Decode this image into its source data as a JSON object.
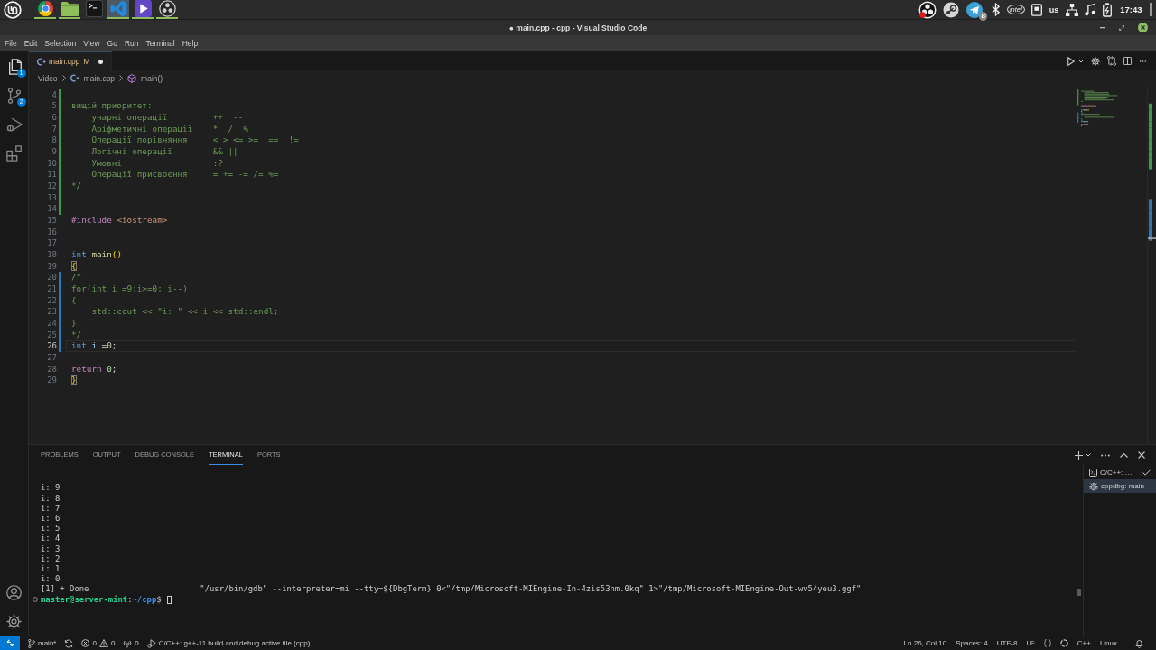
{
  "taskbar": {
    "launchers": [
      {
        "kind": "browser",
        "running": true,
        "selected": false
      },
      {
        "kind": "folder",
        "running": true,
        "selected": false
      },
      {
        "kind": "terminal",
        "running": false,
        "selected": false
      },
      {
        "kind": "editor",
        "running": true,
        "selected": true
      },
      {
        "kind": "player",
        "running": true,
        "selected": false
      },
      {
        "kind": "recorder",
        "running": true,
        "selected": false
      }
    ],
    "tray": [
      {
        "kind": "recorder"
      },
      {
        "kind": "store"
      },
      {
        "kind": "messenger",
        "badge": "8"
      },
      {
        "kind": "bluetooth"
      },
      {
        "kind": "logo",
        "label": "intel"
      },
      {
        "kind": "drive"
      },
      {
        "kind": "layout",
        "label": "us"
      },
      {
        "kind": "network"
      },
      {
        "kind": "sound"
      },
      {
        "kind": "battery"
      }
    ],
    "clock": "17:43"
  },
  "window": {
    "title": "● main.cpp - cpp - Visual Studio Code"
  },
  "menu": [
    "File",
    "Edit",
    "Selection",
    "View",
    "Go",
    "Run",
    "Terminal",
    "Help"
  ],
  "activity_bar": {
    "items": [
      {
        "kind": "explorer",
        "badge": "1",
        "selected": true
      },
      {
        "kind": "source-control",
        "badge": "2",
        "selected": false
      },
      {
        "kind": "run-debug",
        "selected": false
      },
      {
        "kind": "extensions",
        "selected": false
      }
    ],
    "bottom": [
      {
        "kind": "account"
      },
      {
        "kind": "settings"
      }
    ]
  },
  "tabs": [
    {
      "label": "main.cpp",
      "status": "M",
      "modified": true,
      "selected": true
    }
  ],
  "breadcrumbs": [
    {
      "label": "Video",
      "kind": "folder"
    },
    {
      "label": "main.cpp",
      "kind": "file"
    },
    {
      "label": "main()",
      "kind": "symbol"
    }
  ],
  "editor": {
    "lines": [
      {
        "number": "4",
        "added": true,
        "modified": false,
        "current": false
      },
      {
        "number": "5",
        "added": true,
        "modified": false,
        "current": false,
        "tokens": [
          {
            "text": "вищій приоритет:",
            "kind": "comment"
          }
        ]
      },
      {
        "number": "6",
        "added": true,
        "modified": false,
        "current": false,
        "tokens": [
          {
            "text": "    унарні операції         ++  --",
            "kind": "comment"
          }
        ]
      },
      {
        "number": "7",
        "added": true,
        "modified": false,
        "current": false,
        "tokens": [
          {
            "text": "    Аріфметичні операції    *  /  %",
            "kind": "comment"
          }
        ]
      },
      {
        "number": "8",
        "added": true,
        "modified": false,
        "current": false,
        "tokens": [
          {
            "text": "    Операції порівняння     < > <= >=  ==  !=",
            "kind": "comment"
          }
        ]
      },
      {
        "number": "9",
        "added": true,
        "modified": false,
        "current": false,
        "tokens": [
          {
            "text": "    Логічні операції        && ||",
            "kind": "comment"
          }
        ]
      },
      {
        "number": "10",
        "added": true,
        "modified": false,
        "current": false,
        "tokens": [
          {
            "text": "    Умовні                  :?",
            "kind": "comment"
          }
        ]
      },
      {
        "number": "11",
        "added": true,
        "modified": false,
        "current": false,
        "tokens": [
          {
            "text": "    Операції присвоєння     = += -= /= %=",
            "kind": "comment"
          }
        ]
      },
      {
        "number": "12",
        "added": true,
        "modified": false,
        "current": false,
        "tokens": [
          {
            "text": "*/",
            "kind": "comment"
          }
        ]
      },
      {
        "number": "13",
        "added": true,
        "modified": false,
        "current": false
      },
      {
        "number": "14",
        "added": true,
        "modified": false,
        "current": false
      },
      {
        "number": "15",
        "added": false,
        "modified": false,
        "current": false,
        "tokens": [
          {
            "text": "#include",
            "kind": "preproc"
          },
          {
            "text": " <iostream>",
            "kind": "string"
          }
        ]
      },
      {
        "number": "16",
        "added": false,
        "modified": false,
        "current": false
      },
      {
        "number": "17",
        "added": false,
        "modified": false,
        "current": false
      },
      {
        "number": "18",
        "added": false,
        "modified": false,
        "current": false,
        "tokens": [
          {
            "text": "int",
            "kind": "keyword"
          },
          {
            "text": " main",
            "kind": "function"
          },
          {
            "text": "()",
            "kind": "bracket"
          }
        ]
      },
      {
        "number": "19",
        "added": false,
        "modified": false,
        "current": false,
        "tokens": [
          {
            "text": "{",
            "kind": "matched-bracket"
          }
        ]
      },
      {
        "number": "20",
        "added": false,
        "modified": true,
        "current": false,
        "tokens": [
          {
            "text": "/*",
            "kind": "comment"
          }
        ]
      },
      {
        "number": "21",
        "added": false,
        "modified": true,
        "current": false,
        "tokens": [
          {
            "text": "for(int i =9;i>=0; i--)",
            "kind": "comment"
          }
        ]
      },
      {
        "number": "22",
        "added": false,
        "modified": true,
        "current": false,
        "tokens": [
          {
            "text": "{",
            "kind": "comment"
          }
        ]
      },
      {
        "number": "23",
        "added": false,
        "modified": true,
        "current": false,
        "tokens": [
          {
            "text": "    std::cout << \"i: \" << i << std::endl;",
            "kind": "comment"
          }
        ]
      },
      {
        "number": "24",
        "added": false,
        "modified": true,
        "current": false,
        "tokens": [
          {
            "text": "}",
            "kind": "comment"
          }
        ]
      },
      {
        "number": "25",
        "added": false,
        "modified": true,
        "current": false,
        "tokens": [
          {
            "text": "*/",
            "kind": "comment"
          }
        ]
      },
      {
        "number": "26",
        "added": false,
        "modified": true,
        "current": true,
        "tokens": [
          {
            "text": "int",
            "kind": "keyword"
          },
          {
            "text": " i",
            "kind": "variable"
          },
          {
            "text": " =",
            "kind": "punct"
          },
          {
            "text": "0",
            "kind": "number"
          },
          {
            "text": ";",
            "kind": "punct"
          }
        ]
      },
      {
        "number": "27",
        "added": false,
        "modified": false,
        "current": false
      },
      {
        "number": "28",
        "added": false,
        "modified": false,
        "current": false,
        "tokens": [
          {
            "text": "return",
            "kind": "control"
          },
          {
            "text": " 0",
            "kind": "number"
          },
          {
            "text": ";",
            "kind": "punct"
          }
        ]
      },
      {
        "number": "29",
        "added": false,
        "modified": false,
        "current": false,
        "tokens": [
          {
            "text": "}",
            "kind": "matched-bracket"
          }
        ]
      }
    ]
  },
  "panel": {
    "tabs": [
      {
        "label": "PROBLEMS",
        "selected": false
      },
      {
        "label": "OUTPUT",
        "selected": false
      },
      {
        "label": "DEBUG CONSOLE",
        "selected": false
      },
      {
        "label": "TERMINAL",
        "selected": true
      },
      {
        "label": "PORTS",
        "selected": false
      }
    ],
    "terminal": {
      "output": [
        "i: 9",
        "i: 8",
        "i: 7",
        "i: 6",
        "i: 5",
        "i: 4",
        "i: 3",
        "i: 2",
        "i: 1",
        "i: 0",
        "[1] + Done                       \"/usr/bin/gdb\" --interpreter=mi --tty=${DbgTerm} 0<\"/tmp/Microsoft-MIEngine-In-4zis53nm.0kq\" 1>\"/tmp/Microsoft-MIEngine-Out-wv54yeu3.ggf\""
      ],
      "prompt": [
        {
          "text": "master@server-mint",
          "kind": "user"
        },
        {
          "text": ":",
          "kind": "plain"
        },
        {
          "text": "~/cpp",
          "kind": "path"
        },
        {
          "text": "$",
          "kind": "plain"
        }
      ]
    },
    "terminals": [
      {
        "label": "C/C++: …",
        "kind": "task",
        "done": true,
        "selected": false
      },
      {
        "label": "cppdbg: main",
        "kind": "debug",
        "done": false,
        "selected": true
      }
    ]
  },
  "status_bar": {
    "branch": "main*",
    "errors": "0",
    "warnings": "0",
    "ports": "0",
    "task": "C/C++: g++-11 build and debug active file (cpp)",
    "position": "Ln 26, Col 10",
    "indentation": "Spaces: 4",
    "encoding": "UTF-8",
    "line_ending": "LF",
    "language": "C++",
    "platform": "Linux"
  }
}
